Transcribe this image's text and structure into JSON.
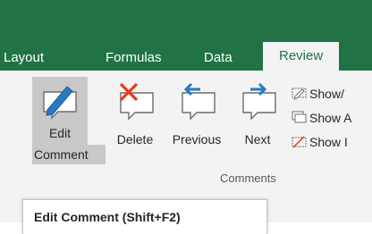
{
  "tabs": [
    {
      "label": "Layout"
    },
    {
      "label": "Formulas"
    },
    {
      "label": "Data"
    },
    {
      "label": "Review"
    }
  ],
  "ribbon": {
    "buttons": {
      "edit_line1": "Edit",
      "edit_line2": "Comment",
      "delete": "Delete",
      "previous": "Previous",
      "next": "Next"
    },
    "small_buttons": [
      {
        "label": "Show/",
        "icon": "show-hide-comment-icon"
      },
      {
        "label": "Show A",
        "icon": "show-all-comments-icon"
      },
      {
        "label": "Show I",
        "icon": "show-ink-icon"
      }
    ],
    "group_label": "Comments"
  },
  "tooltip": {
    "title": "Edit Comment (Shift+F2)"
  },
  "colors": {
    "brand": "#217346",
    "ribbon_bg": "#f3f3f3",
    "delete_accent": "#e8391d",
    "arrow_accent": "#2b79c2"
  }
}
